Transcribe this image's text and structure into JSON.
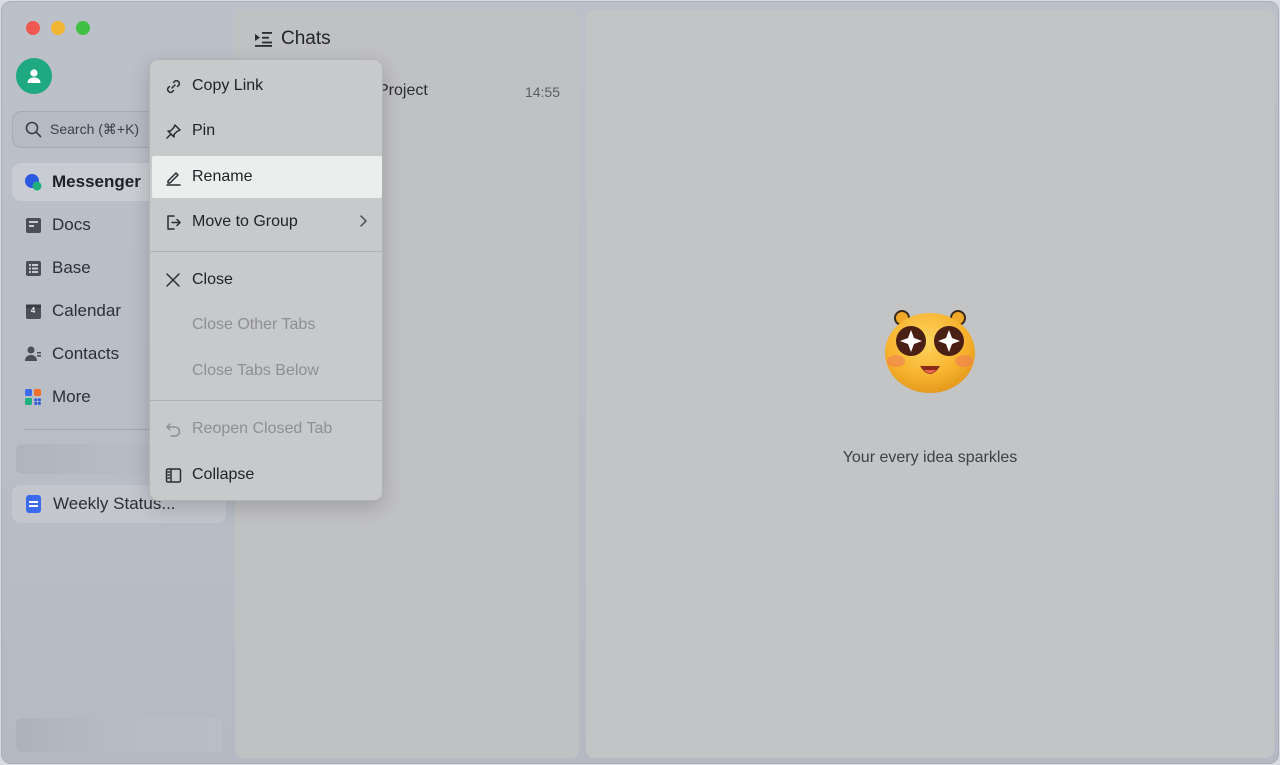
{
  "window": {
    "traffic_lights": [
      "close",
      "minimize",
      "zoom"
    ]
  },
  "sidebar": {
    "search": {
      "label": "Search (⌘+K)"
    },
    "items": [
      {
        "id": "messenger",
        "label": "Messenger",
        "icon": "messenger-icon",
        "active": true
      },
      {
        "id": "docs",
        "label": "Docs",
        "icon": "docs-icon"
      },
      {
        "id": "base",
        "label": "Base",
        "icon": "base-icon"
      },
      {
        "id": "calendar",
        "label": "Calendar",
        "icon": "calendar-icon",
        "badge": "4"
      },
      {
        "id": "contacts",
        "label": "Contacts",
        "icon": "contacts-icon"
      },
      {
        "id": "more",
        "label": "More",
        "icon": "more-apps-icon"
      }
    ],
    "pinned": [
      {
        "label": "Weekly Status...",
        "icon": "document-icon"
      }
    ]
  },
  "chats": {
    "header": "Chats",
    "list": [
      {
        "title_visible": "Project",
        "time": "14:55"
      }
    ]
  },
  "main": {
    "empty_text": "Your every idea sparkles",
    "emoji": "starry-eyes-emoji"
  },
  "context_menu": {
    "groups": [
      [
        {
          "label": "Copy Link",
          "icon": "link-icon",
          "enabled": true
        },
        {
          "label": "Pin",
          "icon": "pin-icon",
          "enabled": true
        },
        {
          "label": "Rename",
          "icon": "pencil-icon",
          "enabled": true,
          "highlighted": true
        },
        {
          "label": "Move to Group",
          "icon": "move-icon",
          "enabled": true,
          "submenu": true
        }
      ],
      [
        {
          "label": "Close",
          "icon": "close-icon",
          "enabled": true
        },
        {
          "label": "Close Other Tabs",
          "enabled": false
        },
        {
          "label": "Close Tabs Below",
          "enabled": false
        }
      ],
      [
        {
          "label": "Reopen Closed Tab",
          "icon": "undo-icon",
          "enabled": false
        },
        {
          "label": "Collapse",
          "icon": "sidebar-collapse-icon",
          "enabled": true
        }
      ]
    ]
  },
  "colors": {
    "accent_green": "#1ea981",
    "doc_blue": "#3b6bf0",
    "menu_highlight": "#eceded"
  }
}
